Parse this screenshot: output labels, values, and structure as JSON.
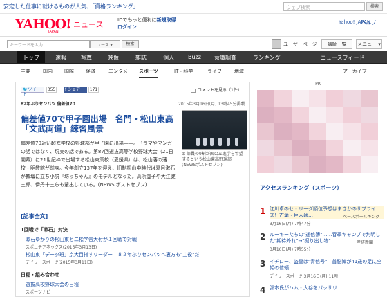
{
  "promo": {
    "text": "安定した仕事に就けるものが人気、「資格ランキング」",
    "search_placeholder": "ウェブ検索",
    "search_button": "検索"
  },
  "header": {
    "logo": "YAHOO!",
    "logo_sub": "JAPAN",
    "service": "ニュース",
    "id_line1": "IDでもっと便利に新規取得",
    "id_line1_plain": "IDでもっと便利に",
    "id_line1_link": "新規取得",
    "id_line2": "ログイン",
    "yahoo_link": "Yahoo! JAPAN",
    "help": "ヘルプ"
  },
  "searchbar": {
    "placeholder": "キーワードを入力",
    "select": "ニュース",
    "button": "検索",
    "user_label": "ユーザーページ",
    "subscribe": "購読一覧",
    "menu": "メニュー"
  },
  "nav1": [
    "トップ",
    "速報",
    "写真",
    "映像",
    "雑誌",
    "個人",
    "Buzz",
    "意識調査",
    "ランキング",
    "ニュースフィード"
  ],
  "nav2": [
    "主要",
    "国内",
    "国際",
    "経済",
    "エンタメ",
    "スポーツ",
    "IT・科学",
    "ライフ",
    "地域",
    "アーカイブ"
  ],
  "article": {
    "tweet": "ツイート",
    "tweet_count": "355",
    "share": "シェア",
    "share_count": "171",
    "comment": "コメントを見る（1件）",
    "category": "82年ぶりセンバツ 偏差値70",
    "datetime": "2015年3月16日(月) 13時45分掲載",
    "title": "偏差値70で甲子園出場　名門・松山東高「文武両道」練習風景",
    "photo_caption": "部員の9割が国公立進学を希望するという松山東高野球部(NEWSポストセブン)",
    "body": "偏差値70近い超進学校の野球部が甲子園に出場——。ドラマやマンガの話ではなく、現実の話である。第87回選抜高等学校野球大会（21日開幕）に21世紀枠で出場する松山東高校（愛媛県）は、松山藩の藩校・明教館が前身。今年創立137年を迎え、旧制松山中時代は夏目漱石が教壇に立ち小説『坊っちゃん』のモデルとなった。高浜虚子や大江健三郎、伊丹十三らも輩出している。(NEWS ポストセブン)",
    "full_link": "[記事全文]",
    "section1": "1回戦で「漱石」対決",
    "rel1": "漱石ゆかりの松山東と二松学舎大付が１回戦で対戦",
    "src1": "スポニチアネックス(2015年3月13日)",
    "rel2": "松山東「データ班」京大目指すリーダー　８２年ぶりセンバツへ裏方も\"主役\"だ",
    "src2": "デイリースポーツ(2015年3月11日)",
    "section2": "日程・組み合わせ",
    "rel3": "選抜高校野球大会の日程",
    "src3": "スポーツナビ"
  },
  "sidebar": {
    "pr": "PR",
    "ranking_title": "アクセスランキング（スポーツ）",
    "items": [
      {
        "rank": "1",
        "text": "江川卓のセ・リーグ順位予想はまさかのサプライズ！古葉・巨人は…",
        "source": "ベースボールキング",
        "time": "3月16日(月) 7時47分"
      },
      {
        "rank": "2",
        "text": "ルーキーたちの\"通信簿\"……春季キャンプで判明した\"期待外れ\"→\"掘り出し物\"",
        "source": "産経新聞",
        "time": "3月16日(月) 7時55分"
      },
      {
        "rank": "3",
        "text": "イチロー、盗塁は\"青信号\"　首脳陣が41歳の足に全幅の信頼",
        "source": "デイリースポーツ",
        "time": "3月16日(月) 11時"
      },
      {
        "rank": "4",
        "text": "張本氏がハム・大谷をバッサリ",
        "source": "",
        "time": ""
      }
    ]
  },
  "colors": {
    "accent": "#1e4fa0",
    "brand": "#ff0033",
    "nav_bg": "#3a3a3a"
  }
}
